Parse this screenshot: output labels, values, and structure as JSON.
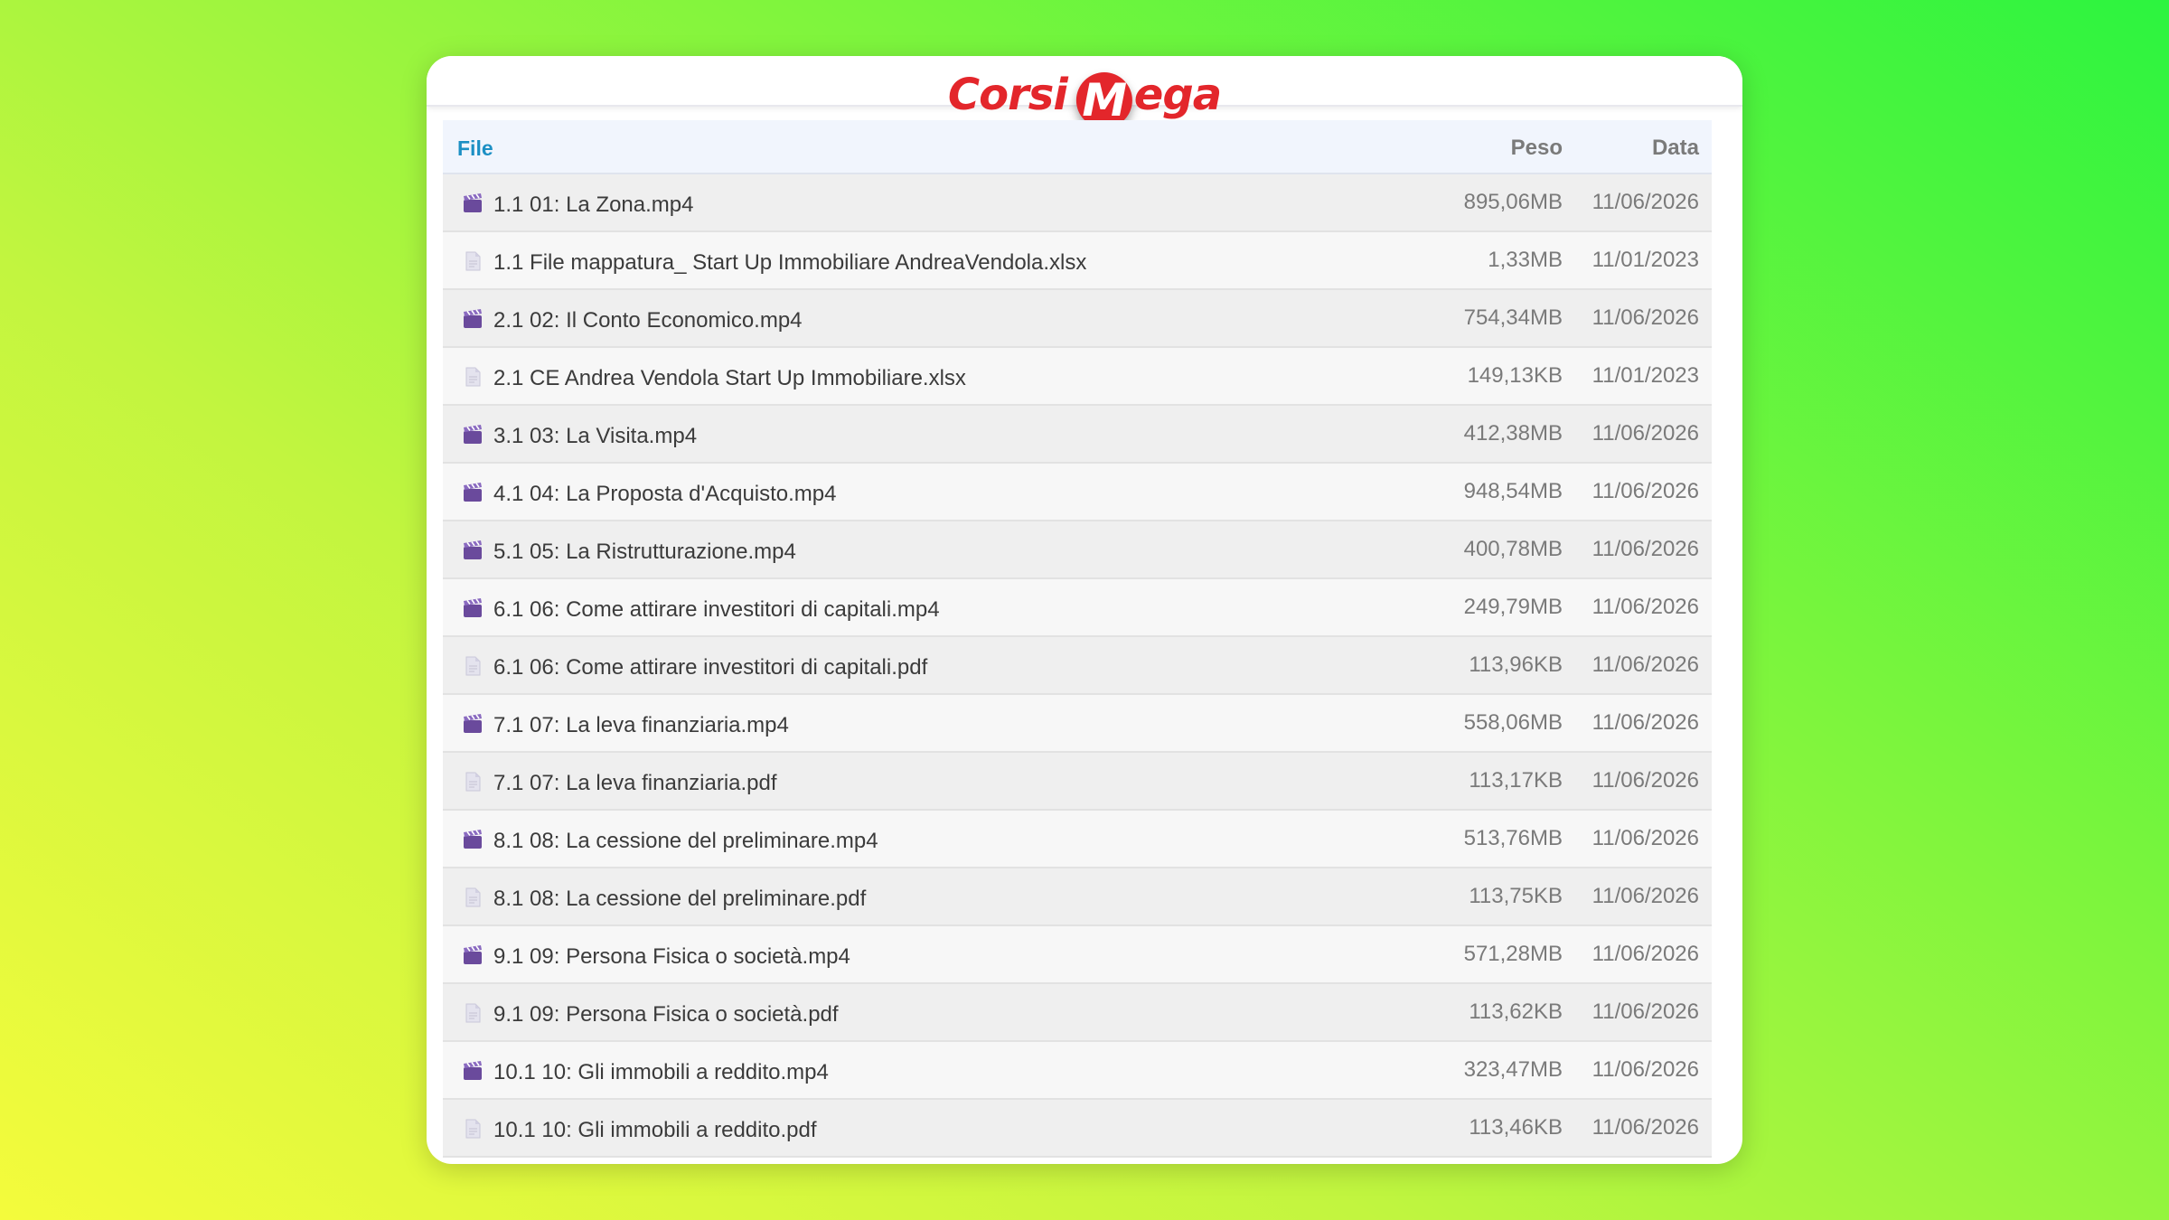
{
  "brand": {
    "logo_word1": "Corsi",
    "logo_m": "M",
    "logo_rest": "ega",
    "color": "#e3262b"
  },
  "table": {
    "headers": {
      "file": "File",
      "size": "Peso",
      "date": "Data"
    },
    "rows": [
      {
        "icon": "video-icon",
        "name": "1.1 01: La Zona.mp4",
        "size": "895,06MB",
        "date": "11/06/2026"
      },
      {
        "icon": "document-icon",
        "name": "1.1 File mappatura_ Start Up Immobiliare AndreaVendola.xlsx",
        "size": "1,33MB",
        "date": "11/01/2023"
      },
      {
        "icon": "video-icon",
        "name": "2.1 02: Il Conto Economico.mp4",
        "size": "754,34MB",
        "date": "11/06/2026"
      },
      {
        "icon": "document-icon",
        "name": "2.1 CE Andrea Vendola Start Up Immobiliare.xlsx",
        "size": "149,13KB",
        "date": "11/01/2023"
      },
      {
        "icon": "video-icon",
        "name": "3.1 03: La Visita.mp4",
        "size": "412,38MB",
        "date": "11/06/2026"
      },
      {
        "icon": "video-icon",
        "name": "4.1 04: La Proposta d'Acquisto.mp4",
        "size": "948,54MB",
        "date": "11/06/2026"
      },
      {
        "icon": "video-icon",
        "name": "5.1 05: La Ristrutturazione.mp4",
        "size": "400,78MB",
        "date": "11/06/2026"
      },
      {
        "icon": "video-icon",
        "name": "6.1 06: Come attirare investitori di capitali.mp4",
        "size": "249,79MB",
        "date": "11/06/2026"
      },
      {
        "icon": "document-icon",
        "name": "6.1 06: Come attirare investitori di capitali.pdf",
        "size": "113,96KB",
        "date": "11/06/2026"
      },
      {
        "icon": "video-icon",
        "name": "7.1 07: La leva finanziaria.mp4",
        "size": "558,06MB",
        "date": "11/06/2026"
      },
      {
        "icon": "document-icon",
        "name": "7.1 07: La leva finanziaria.pdf",
        "size": "113,17KB",
        "date": "11/06/2026"
      },
      {
        "icon": "video-icon",
        "name": "8.1 08: La cessione del preliminare.mp4",
        "size": "513,76MB",
        "date": "11/06/2026"
      },
      {
        "icon": "document-icon",
        "name": "8.1 08: La cessione del preliminare.pdf",
        "size": "113,75KB",
        "date": "11/06/2026"
      },
      {
        "icon": "video-icon",
        "name": "9.1 09: Persona Fisica o società.mp4",
        "size": "571,28MB",
        "date": "11/06/2026"
      },
      {
        "icon": "document-icon",
        "name": "9.1 09: Persona Fisica o società.pdf",
        "size": "113,62KB",
        "date": "11/06/2026"
      },
      {
        "icon": "video-icon",
        "name": "10.1 10: Gli immobili a reddito.mp4",
        "size": "323,47MB",
        "date": "11/06/2026"
      },
      {
        "icon": "document-icon",
        "name": "10.1 10: Gli immobili a reddito.pdf",
        "size": "113,46KB",
        "date": "11/06/2026"
      }
    ]
  }
}
